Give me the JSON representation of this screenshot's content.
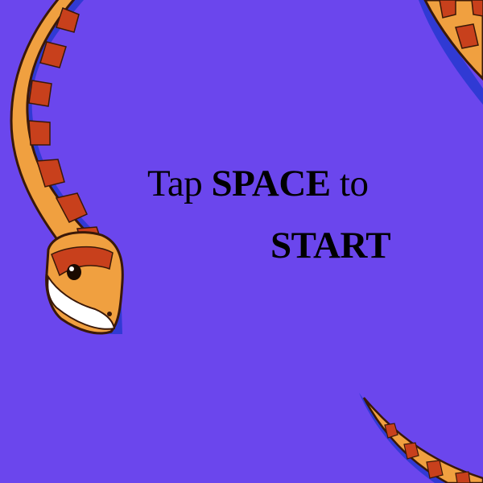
{
  "game": {
    "background_color": "#6b46ed",
    "prompt": {
      "tap_text": "Tap ",
      "key_text": "SPACE",
      "to_text": " to",
      "start_text": "START"
    }
  },
  "decorations": {
    "snake_icon": "snake-icon",
    "snake_colors": {
      "body_orange": "#f0a040",
      "pattern_red": "#c8401c",
      "outline": "#3a1808",
      "belly": "#f8c070",
      "eye": "#1a0a00",
      "lip": "#ffffff"
    }
  }
}
